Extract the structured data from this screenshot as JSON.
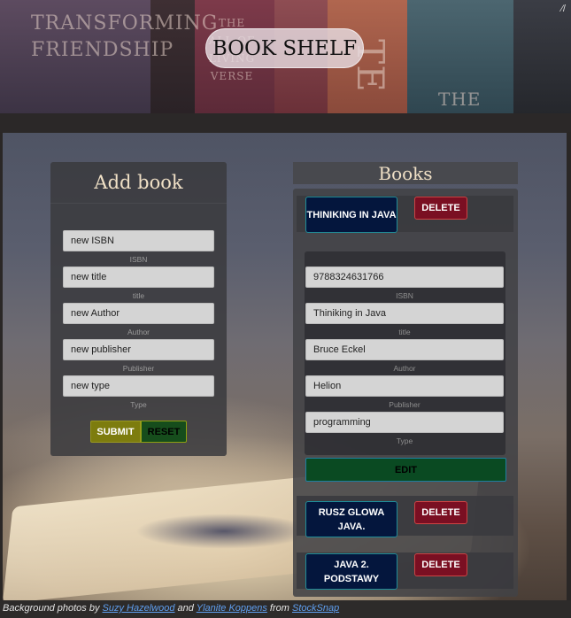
{
  "header": {
    "title": "BOOK SHELF",
    "corner_text": "⁄/",
    "spines": {
      "one": "TRANSFORMING FRIENDSHIP",
      "two": "THE ALL OF LIVING VERSE",
      "three": "TE",
      "four": "THE"
    }
  },
  "add_book": {
    "title": "Add book",
    "fields": [
      {
        "placeholder": "new ISBN",
        "label": "ISBN"
      },
      {
        "placeholder": "new title",
        "label": "title"
      },
      {
        "placeholder": "new Author",
        "label": "Author"
      },
      {
        "placeholder": "new publisher",
        "label": "Publisher"
      },
      {
        "placeholder": "new type",
        "label": "Type"
      }
    ],
    "submit_label": "SUBMIT",
    "reset_label": "RESET"
  },
  "books": {
    "title": "Books",
    "delete_label": "DELETE",
    "items": [
      {
        "title": "THINIKING IN JAVA"
      },
      {
        "title": "RUSZ GLOWA JAVA."
      },
      {
        "title": "JAVA 2. PODSTAWY"
      }
    ],
    "selected": {
      "isbn": "9788324631766",
      "title": "Thiniking in Java",
      "author": "Bruce Eckel",
      "publisher": "Helion",
      "type": "programming",
      "labels": {
        "isbn": "ISBN",
        "title": "title",
        "author": "Author",
        "publisher": "Publisher",
        "type": "Type"
      },
      "edit_label": "EDIT"
    }
  },
  "footer": {
    "prefix": "Background photos by ",
    "credit1": "Suzy Hazelwood",
    "and": " and ",
    "credit2": "Ylanite Koppens",
    "from": " from ",
    "source": "StockSnap"
  }
}
